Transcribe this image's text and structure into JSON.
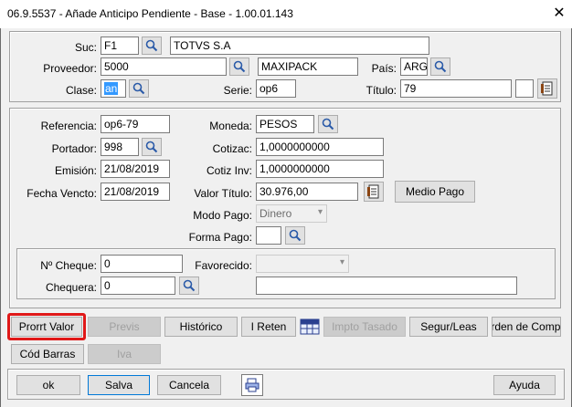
{
  "window": {
    "title": "06.9.5537 - Añade Anticipo Pendiente - Base - 1.00.01.143"
  },
  "header": {
    "suc_label": "Suc:",
    "suc_value": "F1",
    "suc_name": "TOTVS S.A",
    "proveedor_label": "Proveedor:",
    "proveedor_value": "5000",
    "proveedor_name": "MAXIPACK",
    "pais_label": "País:",
    "pais_value": "ARG",
    "clase_label": "Clase:",
    "clase_value": "an",
    "serie_label": "Serie:",
    "serie_value": "op6",
    "titulo_label": "Título:",
    "titulo_value": "79",
    "titulo_extra": ""
  },
  "details": {
    "referencia_label": "Referencia:",
    "referencia_value": "op6-79",
    "portador_label": "Portador:",
    "portador_value": "998",
    "emision_label": "Emisión:",
    "emision_value": "21/08/2019",
    "vencto_label": "Fecha Vencto:",
    "vencto_value": "21/08/2019",
    "moneda_label": "Moneda:",
    "moneda_value": "PESOS",
    "cotizac_label": "Cotizac:",
    "cotizac_value": "1,0000000000",
    "cotizinv_label": "Cotiz Inv:",
    "cotizinv_value": "1,0000000000",
    "valor_label": "Valor Título:",
    "valor_value": "30.976,00",
    "medio_pago_label": "Medio Pago",
    "modo_pago_label": "Modo Pago:",
    "modo_pago_value": "Dinero",
    "forma_pago_label": "Forma Pago:",
    "forma_pago_value": ""
  },
  "cheque": {
    "numero_label": "Nº Cheque:",
    "numero_value": "0",
    "chequera_label": "Chequera:",
    "chequera_value": "0",
    "favorecido_label": "Favorecido:",
    "favorecido_value": "",
    "extra_value": ""
  },
  "actions": {
    "prorrt_valor": "Prorrt Valor",
    "previs": "Previs",
    "historico": "Histórico",
    "i_reten": "I Reten",
    "impto_tasado": "Impto Tasado",
    "segur_leas": "Segur/Leas",
    "orden_compra": "Orden de Compra",
    "cod_barras": "Cód Barras",
    "iva": "Iva"
  },
  "footer": {
    "ok": "ok",
    "salva": "Salva",
    "cancela": "Cancela",
    "ayuda": "Ayuda"
  },
  "colors": {
    "highlight": "#e01818",
    "selection": "#3399ff"
  }
}
